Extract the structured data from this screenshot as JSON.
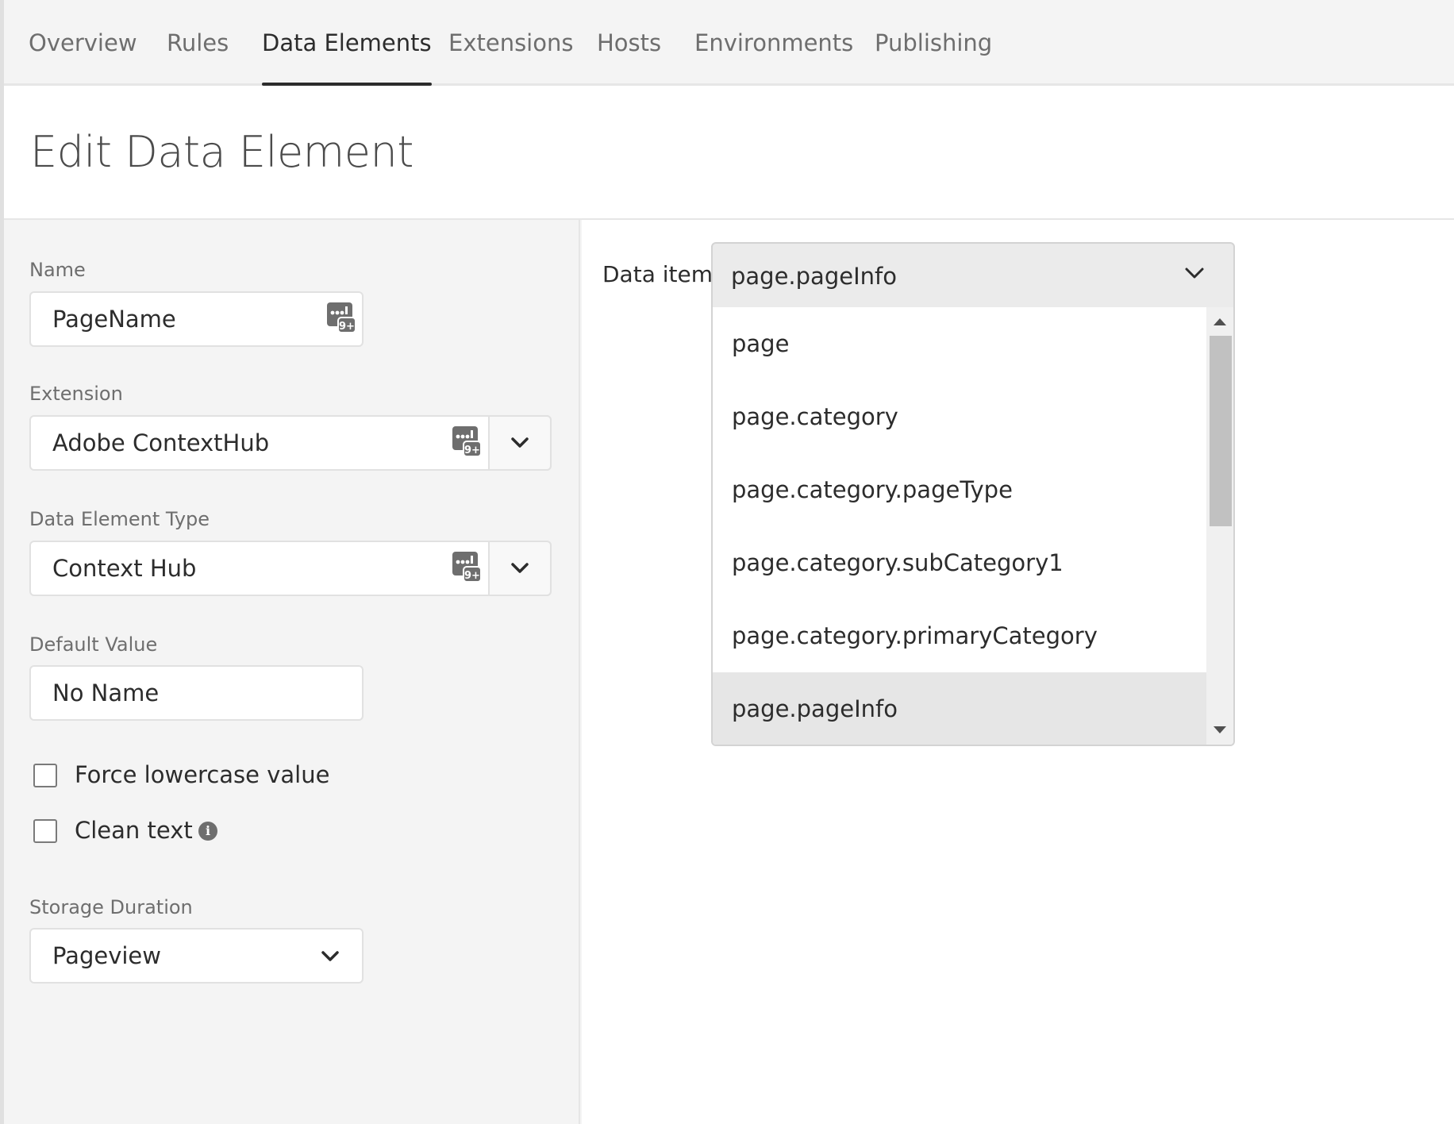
{
  "nav": {
    "tabs": [
      {
        "label": "Overview"
      },
      {
        "label": "Rules"
      },
      {
        "label": "Data Elements",
        "active": true
      },
      {
        "label": "Extensions"
      },
      {
        "label": "Hosts"
      },
      {
        "label": "Environments"
      },
      {
        "label": "Publishing"
      }
    ]
  },
  "page": {
    "title": "Edit Data Element"
  },
  "form": {
    "name": {
      "label": "Name",
      "value": "PageName",
      "icon": "data-element-picker-icon"
    },
    "extension": {
      "label": "Extension",
      "value": "Adobe ContextHub",
      "icon": "data-element-picker-icon"
    },
    "type": {
      "label": "Data Element Type",
      "value": "Context Hub",
      "icon": "data-element-picker-icon"
    },
    "default_value": {
      "label": "Default Value",
      "value": "No Name"
    },
    "force_lowercase": {
      "label": "Force lowercase value",
      "checked": false
    },
    "clean_text": {
      "label": "Clean text",
      "checked": false,
      "icon": "info-icon"
    },
    "storage_duration": {
      "label": "Storage Duration",
      "value": "Pageview"
    }
  },
  "data_item": {
    "label": "Data item",
    "selected": "page.pageInfo",
    "options": [
      "page",
      "page.category",
      "page.category.pageType",
      "page.category.subCategory1",
      "page.category.primaryCategory",
      "page.pageInfo"
    ]
  },
  "colors": {
    "accent": "#2c2c2c",
    "panel_bg": "#f4f4f4",
    "selected_option_bg": "#e6e6e6"
  }
}
